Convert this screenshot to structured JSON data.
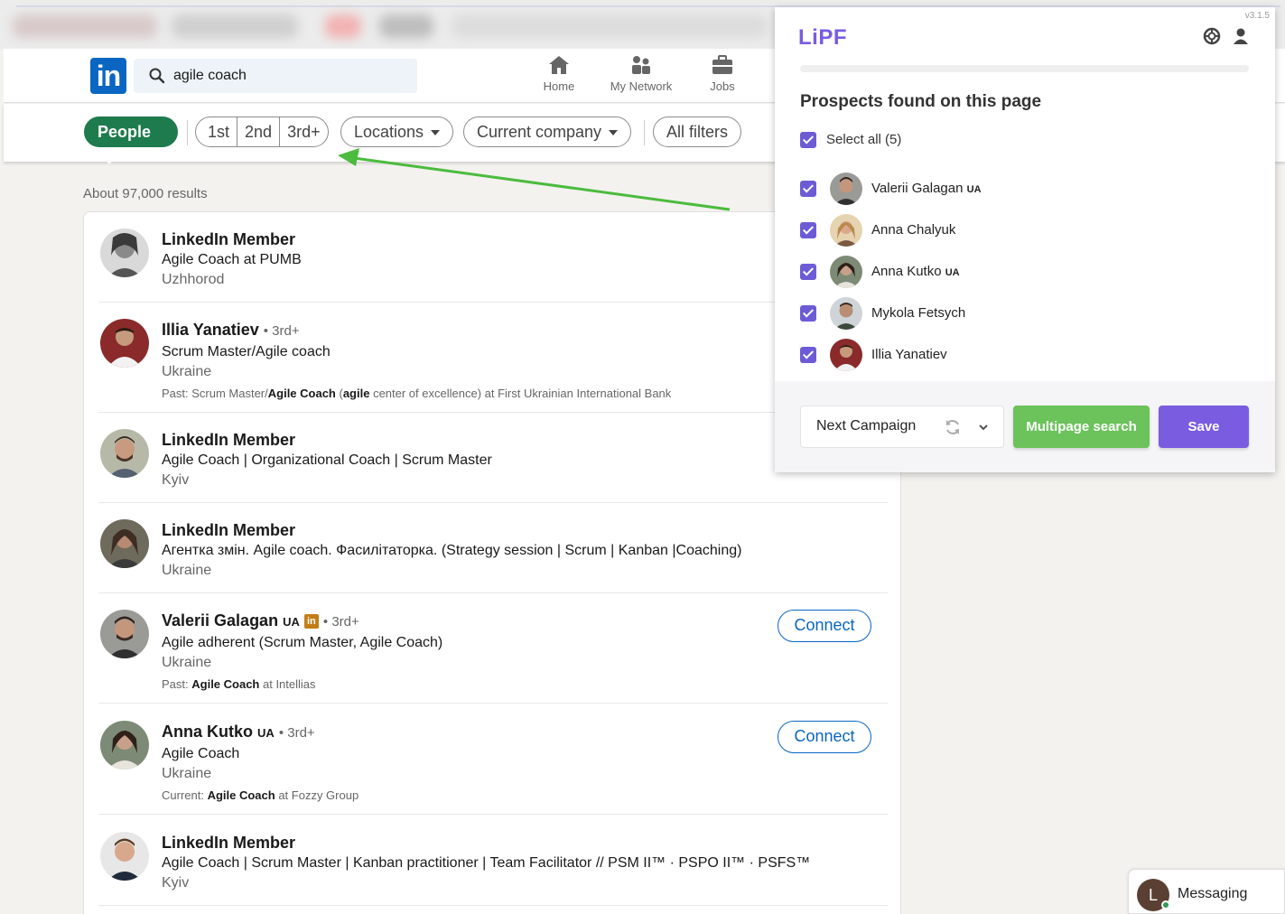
{
  "header": {
    "logo": "in",
    "search_value": "agile coach",
    "nav": [
      {
        "label": "Home",
        "icon": "home-icon"
      },
      {
        "label": "My Network",
        "icon": "my-network-icon"
      },
      {
        "label": "Jobs",
        "icon": "jobs-icon"
      }
    ]
  },
  "filters": {
    "people": "People",
    "connections": [
      "1st",
      "2nd",
      "3rd+"
    ],
    "locations": "Locations",
    "current_company": "Current company",
    "all_filters": "All filters"
  },
  "results": {
    "count": "About 97,000 results",
    "items": [
      {
        "name": "LinkedIn Member",
        "headline": "Agile Coach at PUMB",
        "location": "Uzhhorod"
      },
      {
        "name": "Illia Yanatiev",
        "degree": "• 3rd+",
        "headline": "Scrum Master/Agile coach",
        "location": "Ukraine",
        "past_prefix": "Past: Scrum Master/",
        "past_bold1": "Agile Coach",
        "past_mid": " (",
        "past_bold2": "agile",
        "past_suffix": " center of excellence) at First Ukrainian International Bank"
      },
      {
        "name": "LinkedIn Member",
        "headline": "Agile Coach | Organizational Coach | Scrum Master",
        "location": "Kyiv"
      },
      {
        "name": "LinkedIn Member",
        "headline": "Агентка змін. Agile coach. Фасилітаторка. (Strategy session | Scrum | Kanban |Coaching)",
        "location": "Ukraine"
      },
      {
        "name": "Valerii Galagan",
        "flag": "UA",
        "badge": "in",
        "degree": "• 3rd+",
        "headline": "Agile adherent (Scrum Master, Agile Coach)",
        "location": "Ukraine",
        "past_prefix": "Past: ",
        "past_bold1": "Agile Coach",
        "past_suffix": " at Intellias",
        "connect": "Connect"
      },
      {
        "name": "Anna Kutko",
        "flag": "UA",
        "degree": "• 3rd+",
        "headline": "Agile Coach",
        "location": "Ukraine",
        "past_prefix": "Current: ",
        "past_bold1": "Agile Coach",
        "past_suffix": " at Fozzy Group",
        "connect": "Connect"
      },
      {
        "name": "LinkedIn Member",
        "headline": "Agile Coach | Scrum Master | Kanban practitioner | Team Facilitator // PSM II™ · PSPO II™ · PSFS™",
        "location": "Kyiv"
      }
    ]
  },
  "lipf": {
    "version": "v3.1.5",
    "brand": "LiPF",
    "title": "Prospects found on this page",
    "select_all": "Select all (5)",
    "prospects": [
      {
        "name": "Valerii Galagan",
        "flag": "UA"
      },
      {
        "name": "Anna Chalyuk",
        "flag": ""
      },
      {
        "name": "Anna Kutko",
        "flag": "UA"
      },
      {
        "name": "Mykola Fetsych",
        "flag": ""
      },
      {
        "name": "Illia Yanatiev",
        "flag": ""
      }
    ],
    "campaign": "Next Campaign",
    "multipage": "Multipage search",
    "save": "Save",
    "accent": "#7a5ce0",
    "green": "#6cc25b"
  },
  "messaging": {
    "initial": "L",
    "label": "Messaging"
  }
}
